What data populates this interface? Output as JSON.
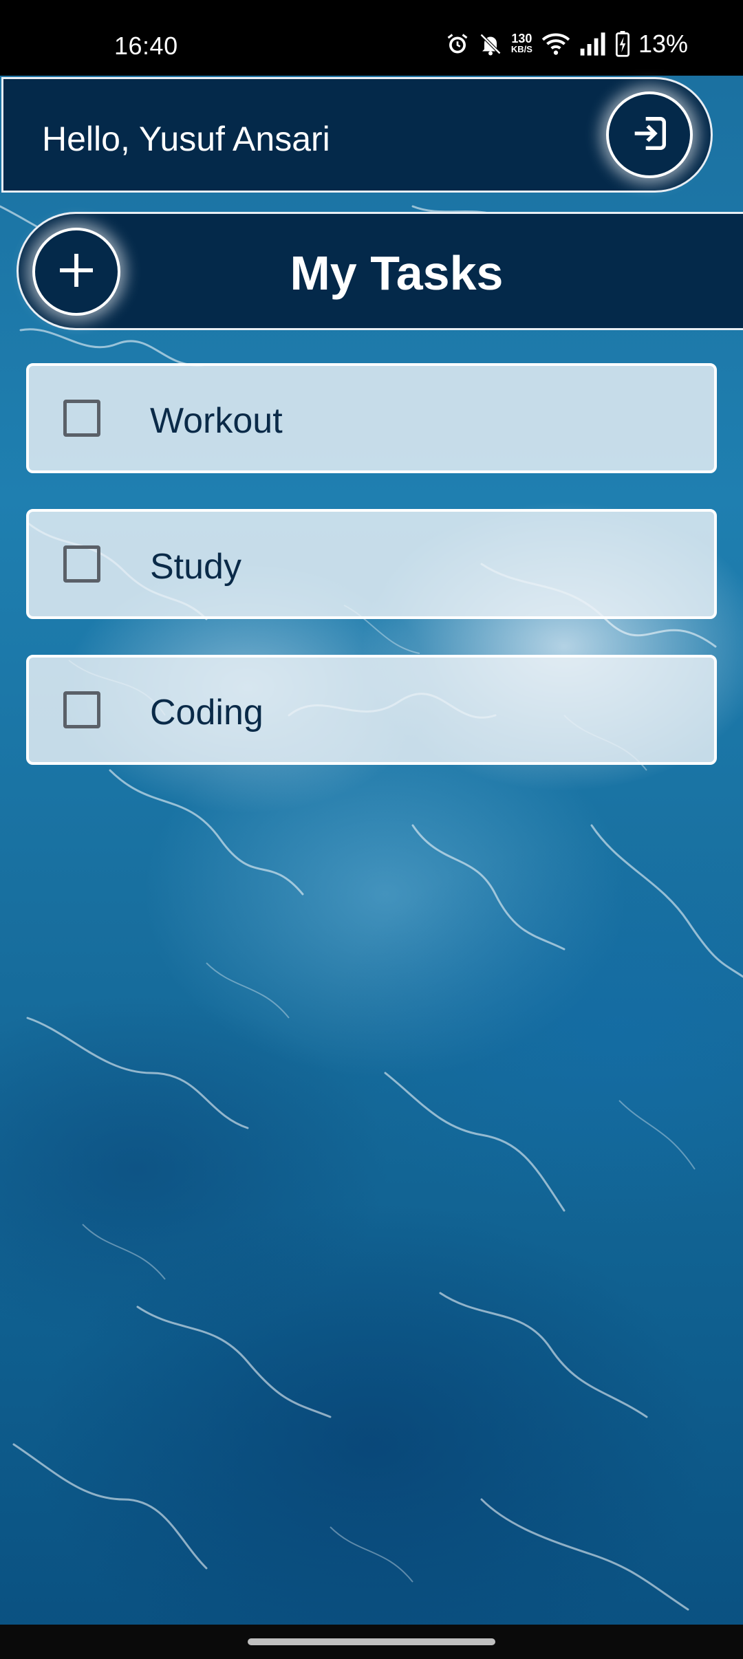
{
  "status_bar": {
    "time": "16:40",
    "net_speed_value": "130",
    "net_speed_unit": "KB/S",
    "battery_percent": "13%",
    "icons": [
      "alarm-icon",
      "bell-off-icon",
      "wifi-icon",
      "signal-icon",
      "battery-charging-icon"
    ]
  },
  "header": {
    "greeting": "Hello, Yusuf Ansari",
    "logout_icon": "logout-icon"
  },
  "title_bar": {
    "title": "My Tasks",
    "add_icon": "plus-icon"
  },
  "tasks": [
    {
      "label": "Workout",
      "checked": false
    },
    {
      "label": "Study",
      "checked": false
    },
    {
      "label": "Coding",
      "checked": false
    }
  ],
  "colors": {
    "header_bg": "#04294a",
    "task_text": "#0a2a48",
    "outline": "#ffffff"
  }
}
